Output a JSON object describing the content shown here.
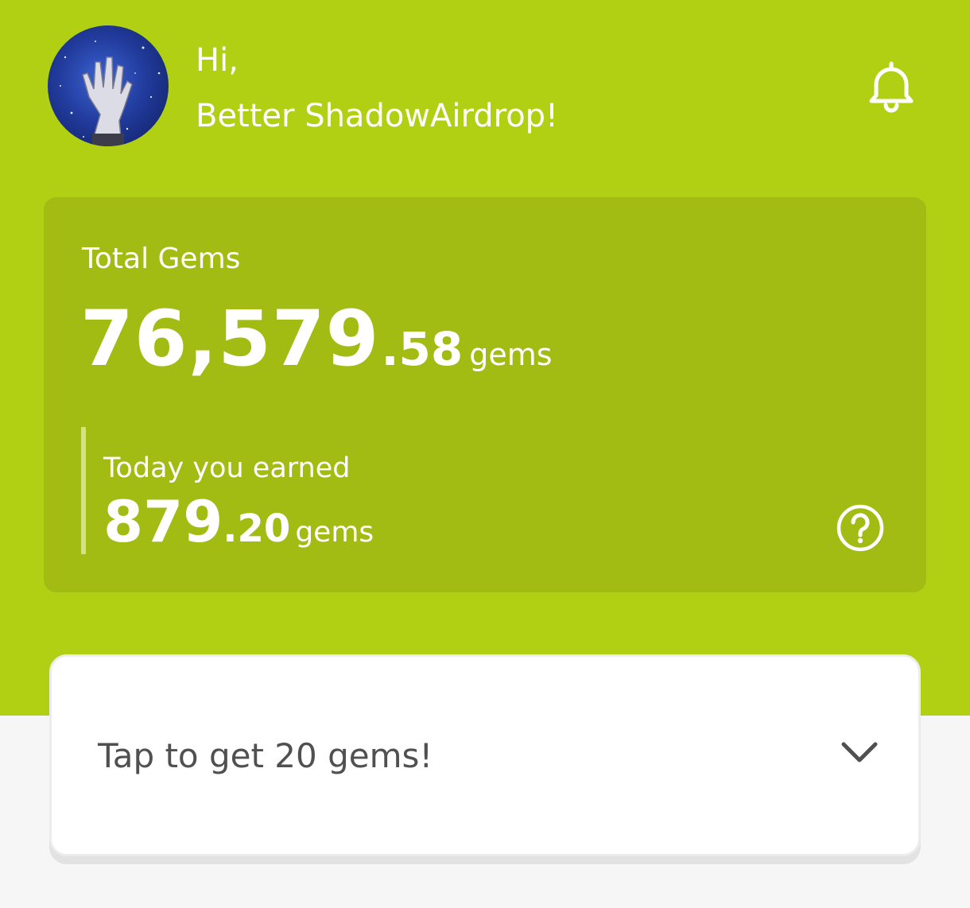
{
  "header": {
    "greeting": "Hi,",
    "user_name": "Better ShadowAirdrop!",
    "avatar_icon": "avatar-hand-galaxy",
    "notification_icon": "bell-icon"
  },
  "total_gems": {
    "label": "Total Gems",
    "integer": "76,579",
    "decimal": ".58",
    "unit": "gems"
  },
  "today": {
    "label": "Today you earned",
    "integer": "879",
    "decimal": ".20",
    "unit": "gems",
    "help_icon": "question-circle-icon"
  },
  "tap_action": {
    "label": "Tap to get 20 gems!",
    "icon": "chevron-down-icon"
  },
  "colors": {
    "hero_background": "#b1d014",
    "card_background": "#a2bc13",
    "page_background": "#f6f6f6",
    "text_light": "#ffffff",
    "text_dark": "#505050"
  }
}
